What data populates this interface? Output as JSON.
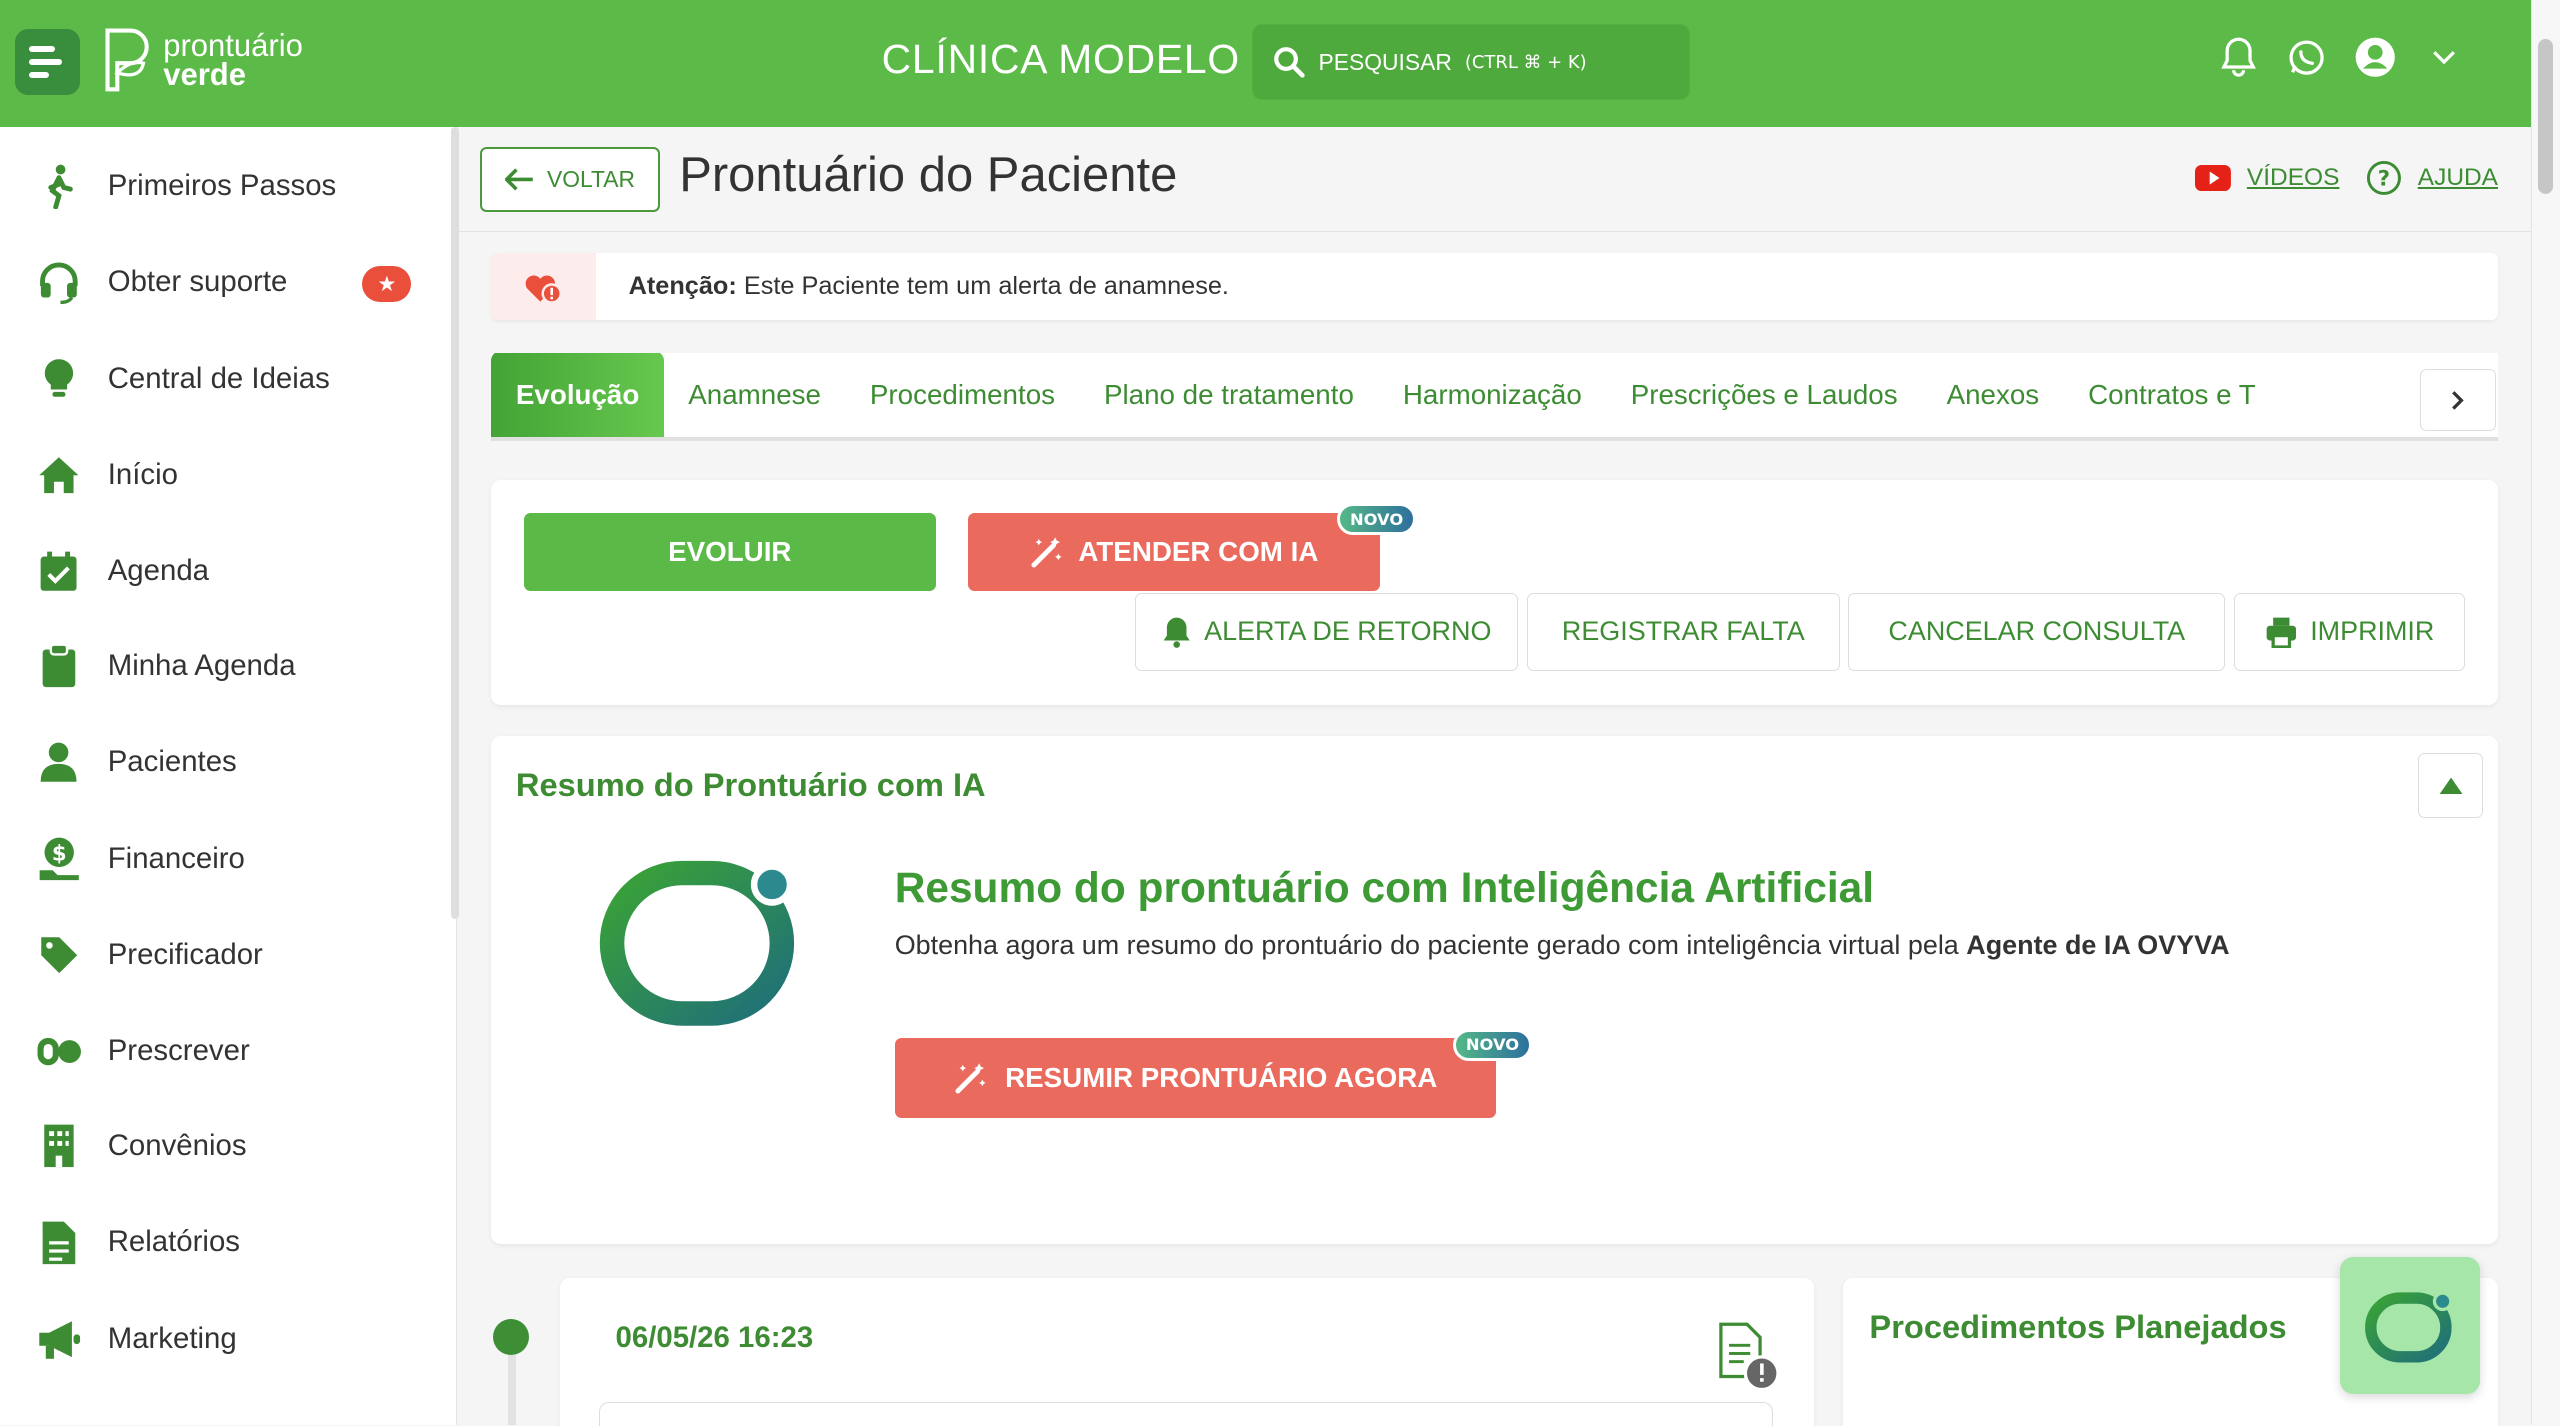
{
  "brand": {
    "name_line1": "prontuário",
    "name_line2": "verde",
    "primary": "#5cbb48",
    "dark": "#3d8c33",
    "coral": "#eb6a5e"
  },
  "header": {
    "clinic": "CLÍNICA MODELO",
    "search_label": "PESQUISAR",
    "search_hint": "(CTRL ⌘ + K)"
  },
  "sidebar": {
    "items": [
      {
        "label": "Primeiros Passos",
        "icon": "walking-icon"
      },
      {
        "label": "Obter suporte",
        "icon": "headset-icon"
      },
      {
        "label": "Central de Ideias",
        "icon": "lightbulb-icon"
      },
      {
        "label": "Início",
        "icon": "home-icon"
      },
      {
        "label": "Agenda",
        "icon": "calendar-icon"
      },
      {
        "label": "Minha Agenda",
        "icon": "clipboard-icon"
      },
      {
        "label": "Pacientes",
        "icon": "user-icon"
      },
      {
        "label": "Financeiro",
        "icon": "money-icon"
      },
      {
        "label": "Precificador",
        "icon": "tag-icon"
      },
      {
        "label": "Prescrever",
        "icon": "pills-icon"
      },
      {
        "label": "Convênios",
        "icon": "building-icon"
      },
      {
        "label": "Relatórios",
        "icon": "report-icon"
      },
      {
        "label": "Marketing",
        "icon": "megaphone-icon"
      }
    ],
    "support_badge": "★"
  },
  "page": {
    "back_label": "VOLTAR",
    "title": "Prontuário do Paciente",
    "videos_label": "VÍDEOS",
    "help_label": "AJUDA"
  },
  "alert": {
    "strong": "Atenção:",
    "text": " Este Paciente tem um alerta de anamnese."
  },
  "tabs": [
    "Evolução",
    "Anamnese",
    "Procedimentos",
    "Plano de tratamento",
    "Harmonização",
    "Prescrições e Laudos",
    "Anexos",
    "Contratos e T"
  ],
  "actions": {
    "evoluir": "EVOLUIR",
    "atender_ia": "ATENDER COM IA",
    "novo": "NOVO",
    "alerta_retorno": "ALERTA DE RETORNO",
    "registrar_falta": "REGISTRAR FALTA",
    "cancelar_consulta": "CANCELAR CONSULTA",
    "imprimir": "IMPRIMIR"
  },
  "summary": {
    "title": "Resumo do Prontuário com IA",
    "heading": "Resumo do prontuário com Inteligência Artificial",
    "text": "Obtenha agora um resumo do prontuário do paciente gerado com inteligência virtual pela ",
    "agent": "Agente de IA OVYVA",
    "button": "RESUMIR PRONTUÁRIO AGORA",
    "novo": "NOVO"
  },
  "evolution": {
    "date": "06/05/26 16:23"
  },
  "procedures": {
    "title": "Procedimentos Planejados"
  }
}
